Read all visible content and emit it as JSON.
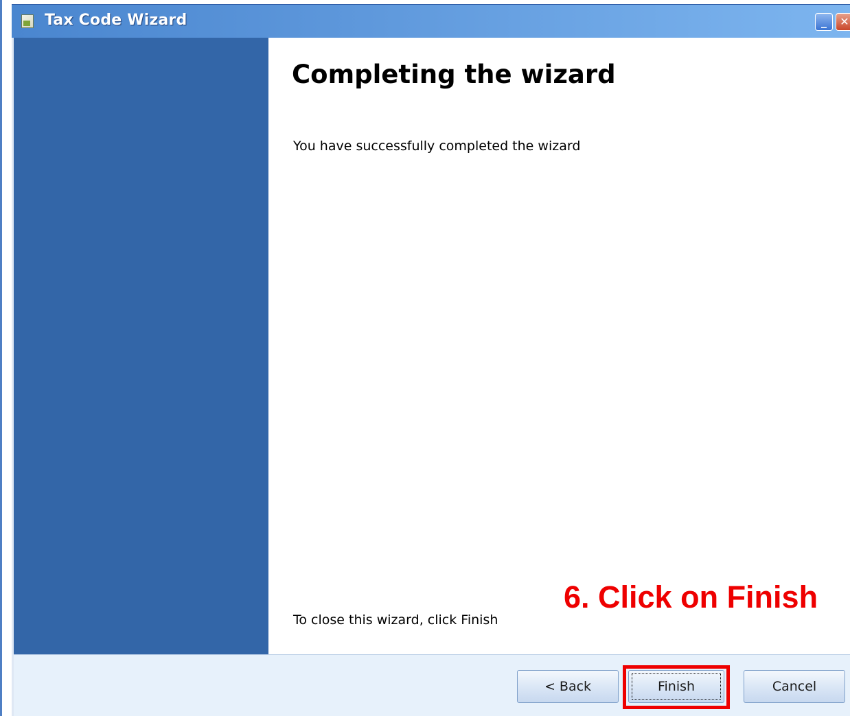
{
  "window": {
    "title": "Tax Code Wizard",
    "icon": "wizard-app-icon"
  },
  "page": {
    "heading": "Completing the wizard",
    "message": "You have successfully completed the wizard",
    "footer_note": "To close this wizard, click Finish"
  },
  "annotation": {
    "text": "6. Click on Finish",
    "color": "#ee0000"
  },
  "buttons": {
    "back_label": "< Back",
    "finish_label": "Finish",
    "cancel_label": "Cancel"
  },
  "colors": {
    "sidebar": "#3366a8",
    "titlebar": "#5d97db",
    "button_bar": "#e7f1fb",
    "highlight": "#ee0000"
  }
}
